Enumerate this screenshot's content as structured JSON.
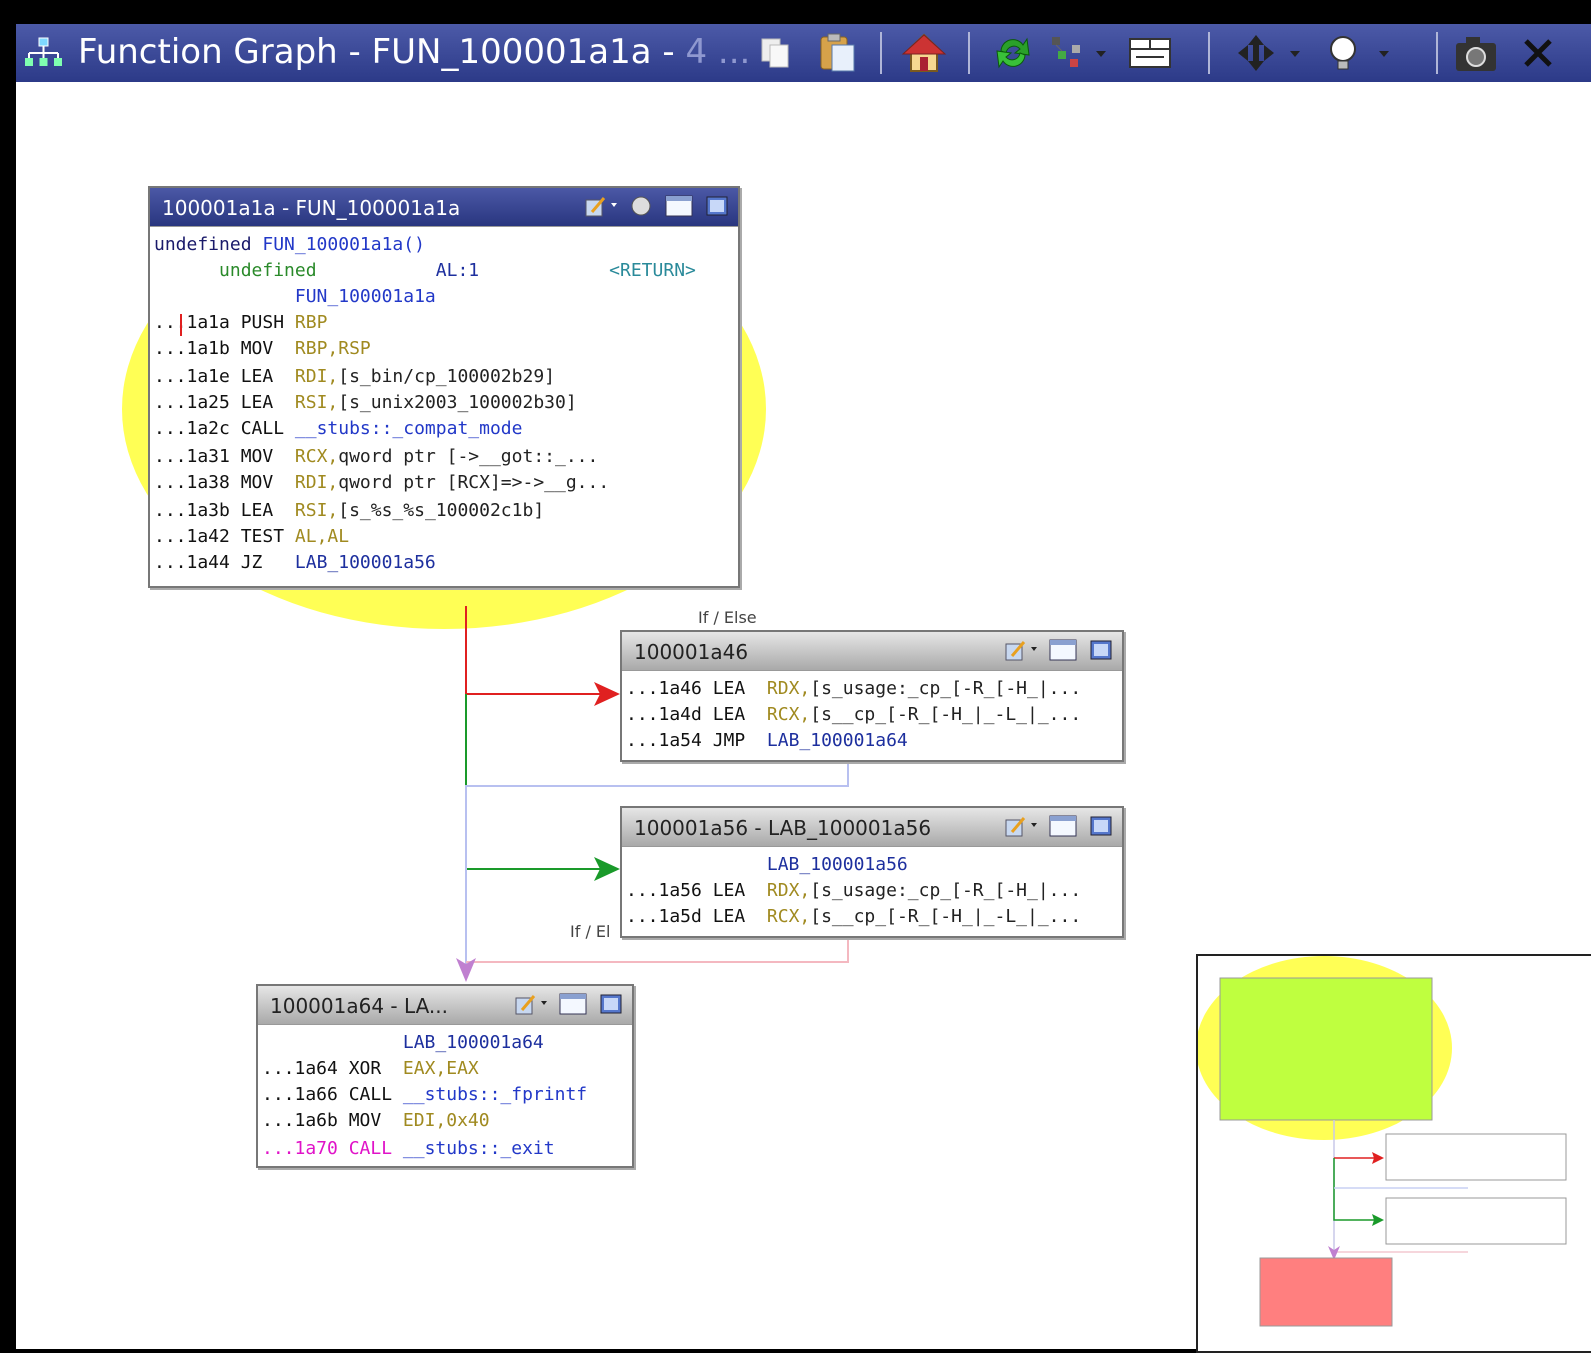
{
  "window": {
    "title": "Function Graph - FUN_100001a1a - 4 ...",
    "title_main": "Function Graph - FUN_100001a1a - ",
    "title_fade": "4 ..."
  },
  "toolbar": {
    "icons": [
      "copy-icon",
      "paste-icon",
      "home-icon",
      "refresh-icon",
      "layout-icon",
      "format-icon",
      "navigate-icon",
      "hint-icon",
      "snapshot-icon",
      "close-icon"
    ]
  },
  "blocks": {
    "entry": {
      "header": "100001a1a - FUN_100001a1a",
      "lines": [
        {
          "a": "undefined ",
          "b": "FUN_100001a1a()",
          "c": ""
        },
        {
          "a": "      undefined",
          "b": "           AL:1",
          "c": "            <RETURN>"
        },
        {
          "a": "",
          "b": "             FUN_100001a1a",
          "c": ""
        },
        {
          "a": "...1a1a PUSH ",
          "b": "RBP",
          "c": ""
        },
        {
          "a": "...1a1b MOV  ",
          "b": "RBP,RSP",
          "c": ""
        },
        {
          "a": "...1a1e LEA  ",
          "b": "RDI,",
          "c": "[s_bin/cp_100002b29]"
        },
        {
          "a": "...1a25 LEA  ",
          "b": "RSI,",
          "c": "[s_unix2003_100002b30]"
        },
        {
          "a": "...1a2c CALL ",
          "b": "",
          "c": "__stubs::_compat_mode"
        },
        {
          "a": "...1a31 MOV  ",
          "b": "RCX,",
          "c": "qword ptr [->__got::_..."
        },
        {
          "a": "...1a38 MOV  ",
          "b": "RDI,",
          "c": "qword ptr [RCX]=>->__g..."
        },
        {
          "a": "...1a3b LEA  ",
          "b": "RSI,",
          "c": "[s_%s_%s_100002c1b]"
        },
        {
          "a": "...1a42 TEST ",
          "b": "AL,AL",
          "c": ""
        },
        {
          "a": "...1a44 JZ   ",
          "b": "",
          "c": "LAB_100001a56"
        }
      ]
    },
    "b1a46": {
      "header": "100001a46",
      "lines": [
        {
          "a": "...1a46 LEA  ",
          "b": "RDX,",
          "c": "[s_usage:_cp_[-R_[-H_|..."
        },
        {
          "a": "...1a4d LEA  ",
          "b": "RCX,",
          "c": "[s__cp_[-R_[-H_|_-L_|_..."
        },
        {
          "a": "...1a54 JMP  ",
          "b": "",
          "c": "LAB_100001a64"
        }
      ]
    },
    "b1a56": {
      "header": "100001a56 - LAB_100001a56",
      "lines": [
        {
          "a": "",
          "b": "             LAB_100001a56",
          "c": ""
        },
        {
          "a": "...1a56 LEA  ",
          "b": "RDX,",
          "c": "[s_usage:_cp_[-R_[-H_|..."
        },
        {
          "a": "...1a5d LEA  ",
          "b": "RCX,",
          "c": "[s__cp_[-R_[-H_|_-L_|_..."
        }
      ]
    },
    "b1a64": {
      "header": "100001a64 - LA...",
      "lines": [
        {
          "a": "",
          "b": "             LAB_100001a64",
          "c": ""
        },
        {
          "a": "...1a64 XOR  ",
          "b": "EAX,EAX",
          "c": ""
        },
        {
          "a": "...1a66 CALL ",
          "b": "",
          "c": "__stubs::_fprintf"
        },
        {
          "a": "...1a6b MOV  ",
          "b": "EDI,0x40",
          "c": ""
        },
        {
          "a": "...1a70 CALL ",
          "b": "",
          "c": "__stubs::_exit"
        }
      ]
    }
  },
  "edges": {
    "label1": "If / Else",
    "label2": "If / El"
  },
  "colors": {
    "highlight": "#ffff55",
    "edge_true": "#e02020",
    "edge_false": "#1a9a2a",
    "edge_uncond": "#b8c0f0",
    "edge_to_exit": "#c080d0",
    "sat_entry": "#bfff3f",
    "sat_exit": "#ff7f7f"
  }
}
